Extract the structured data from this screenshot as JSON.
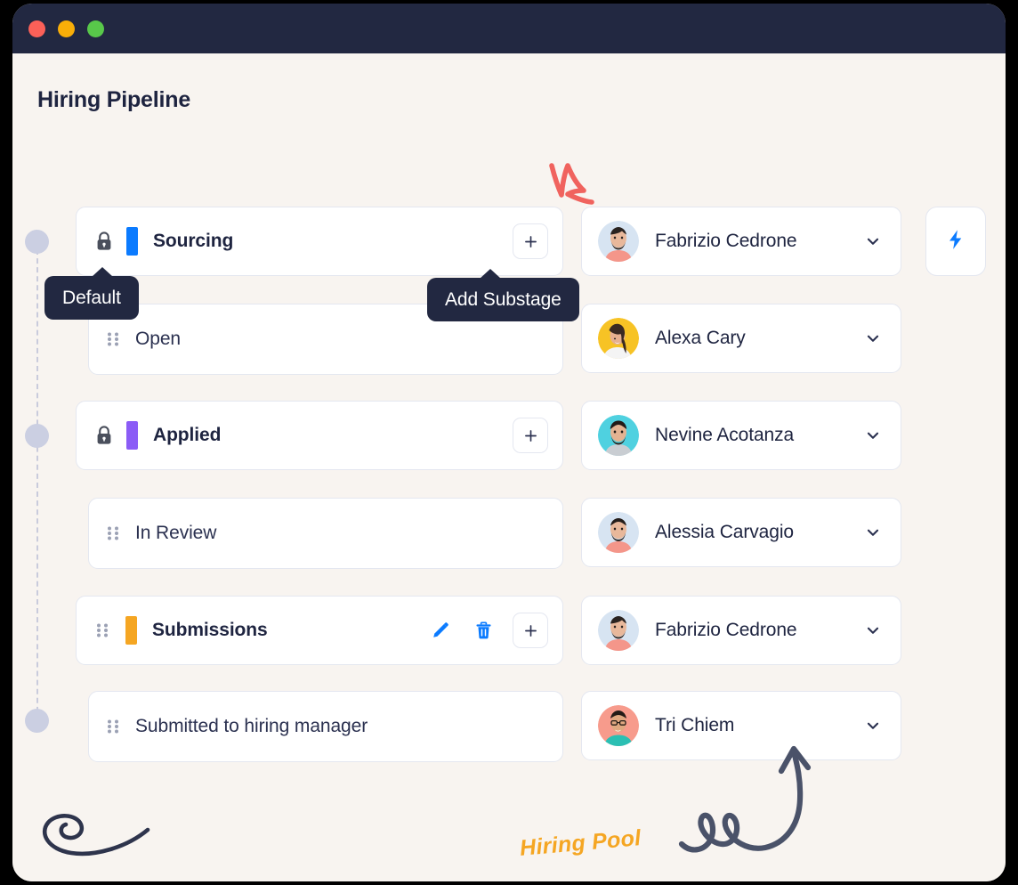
{
  "window": {
    "traffic_lights": [
      "close",
      "minimize",
      "maximize"
    ],
    "colors": {
      "titlebar": "#222841",
      "canvas": "#F8F4F0",
      "accent_blue": "#0B7BFF",
      "accent_orange": "#F5A623",
      "accent_purple": "#8B5CF6",
      "tooltip_bg": "#222841",
      "arrow_red": "#F0635E",
      "arrow_navy": "#4A5269"
    }
  },
  "header": {
    "title": "Hiring Pipeline"
  },
  "tooltips": {
    "default": "Default",
    "add_substage": "Add Substage"
  },
  "pipeline": {
    "stages": [
      {
        "name": "Sourcing",
        "locked": true,
        "color": "#0B7BFF",
        "draggable": false,
        "actions": [
          "add"
        ],
        "substages": [
          {
            "name": "Open",
            "draggable": true
          }
        ]
      },
      {
        "name": "Applied",
        "locked": true,
        "color": "#8B5CF6",
        "draggable": false,
        "actions": [
          "add"
        ],
        "substages": [
          {
            "name": "In Review",
            "draggable": true
          }
        ]
      },
      {
        "name": "Submissions",
        "locked": false,
        "color": "#F5A623",
        "draggable": true,
        "actions": [
          "edit",
          "delete",
          "add"
        ],
        "substages": [
          {
            "name": "Submitted to hiring manager",
            "draggable": true
          }
        ]
      }
    ]
  },
  "candidates": [
    {
      "name": "Fabrizio Cedrone",
      "avatar_bg": "#D7E4F2",
      "shirt": "#F4968A",
      "skin": "#E8B89B",
      "hair": "#2A2320",
      "glasses": false
    },
    {
      "name": "Alexa Cary",
      "avatar_bg": "#F7C325",
      "shirt": "#F2F2F2",
      "skin": "#E6B08F",
      "hair": "#3A2A22",
      "glasses": false
    },
    {
      "name": "Nevine Acotanza",
      "avatar_bg": "#4FD1E0",
      "shirt": "#C9CDD2",
      "skin": "#E3B392",
      "hair": "#221B18",
      "glasses": false
    },
    {
      "name": "Alessia Carvagio",
      "avatar_bg": "#D7E4F2",
      "shirt": "#F4968A",
      "skin": "#E8B89B",
      "hair": "#241D1A",
      "glasses": false
    },
    {
      "name": "Fabrizio Cedrone",
      "avatar_bg": "#D7E4F2",
      "shirt": "#F4968A",
      "skin": "#E8B89B",
      "hair": "#2A2320",
      "glasses": false
    },
    {
      "name": "Tri Chiem",
      "avatar_bg": "#F79B8C",
      "shirt": "#2BBFB3",
      "skin": "#E0A880",
      "hair": "#241B16",
      "glasses": true
    }
  ],
  "quick_action": {
    "icon": "lightning-bolt",
    "color": "#0B7BFF"
  },
  "annotations": {
    "hiring_pool_label": "Hiring Pool"
  }
}
